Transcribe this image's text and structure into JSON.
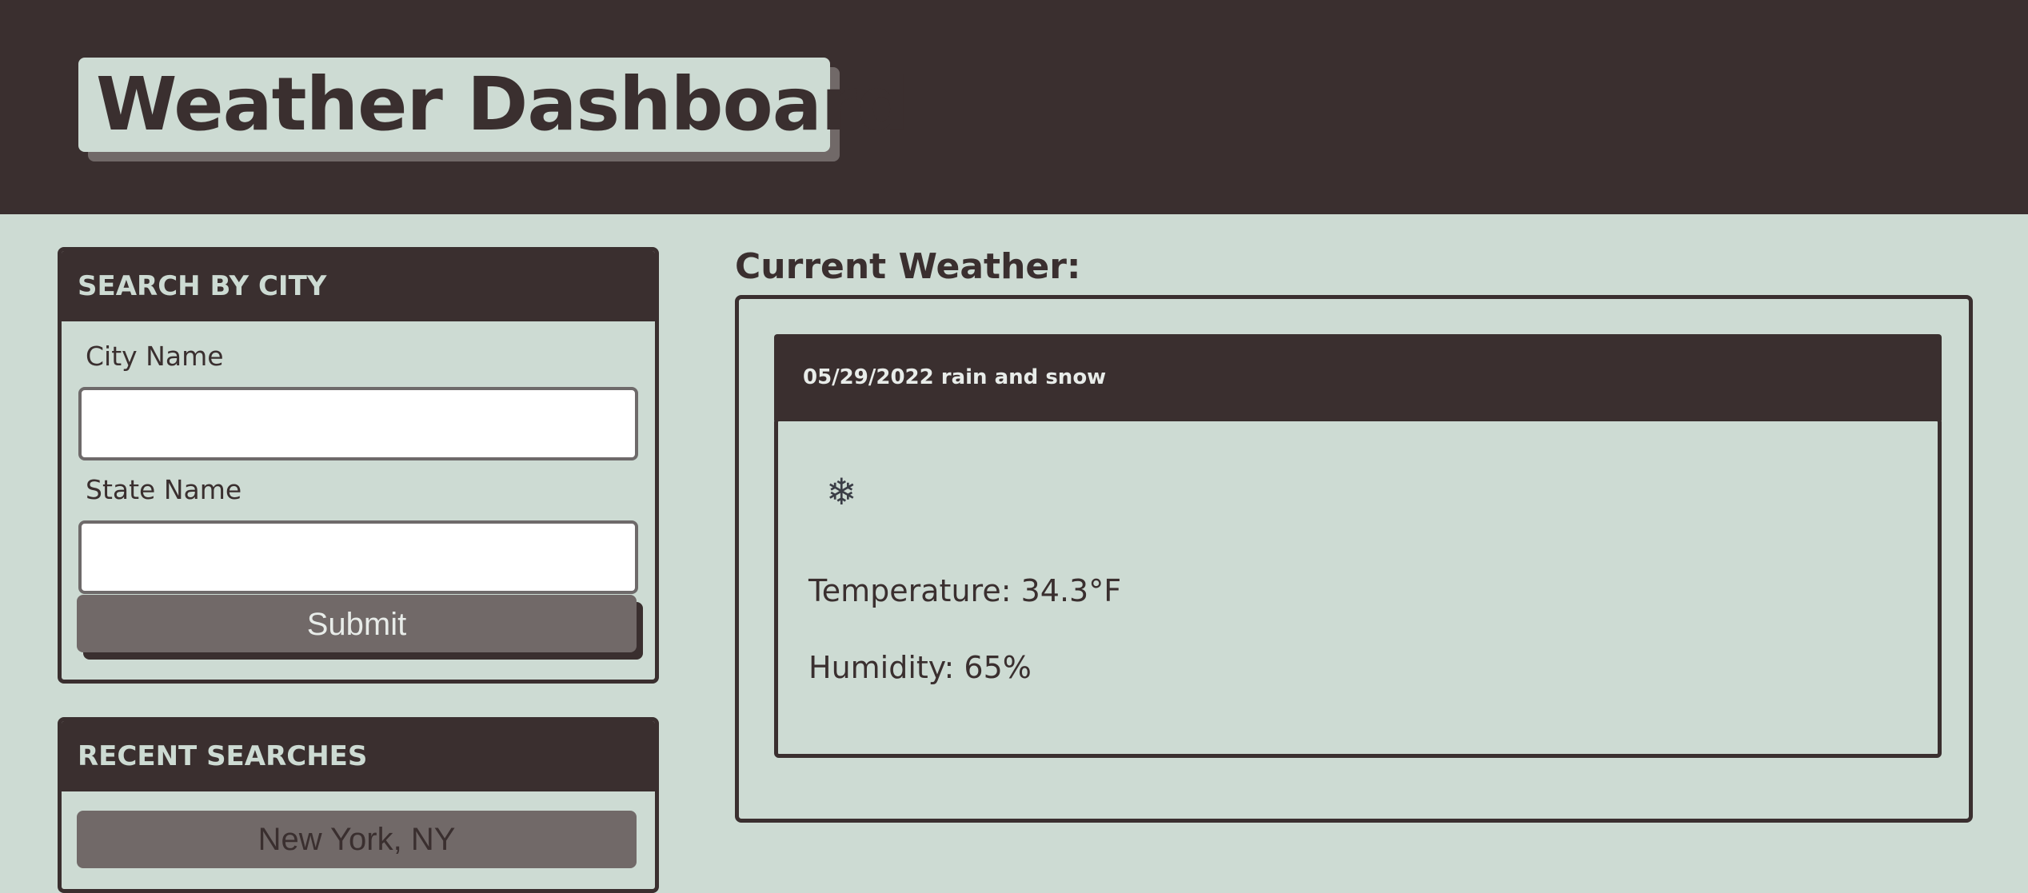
{
  "header": {
    "title": "Weather Dashboard"
  },
  "search": {
    "heading": "SEARCH BY CITY",
    "city_label": "City Name",
    "city_value": "",
    "state_label": "State Name",
    "state_value": "",
    "submit_label": "Submit"
  },
  "recent": {
    "heading": "RECENT SEARCHES",
    "items": [
      "New York, NY"
    ]
  },
  "current": {
    "heading": "Current Weather:",
    "summary": "05/29/2022 rain and snow",
    "icon": "snowflake-icon",
    "temperature": "Temperature: 34.3°F",
    "humidity": "Humidity: 65%"
  },
  "colors": {
    "dark": "#3a2f2f",
    "background": "#cddbd3",
    "button": "#716968"
  }
}
